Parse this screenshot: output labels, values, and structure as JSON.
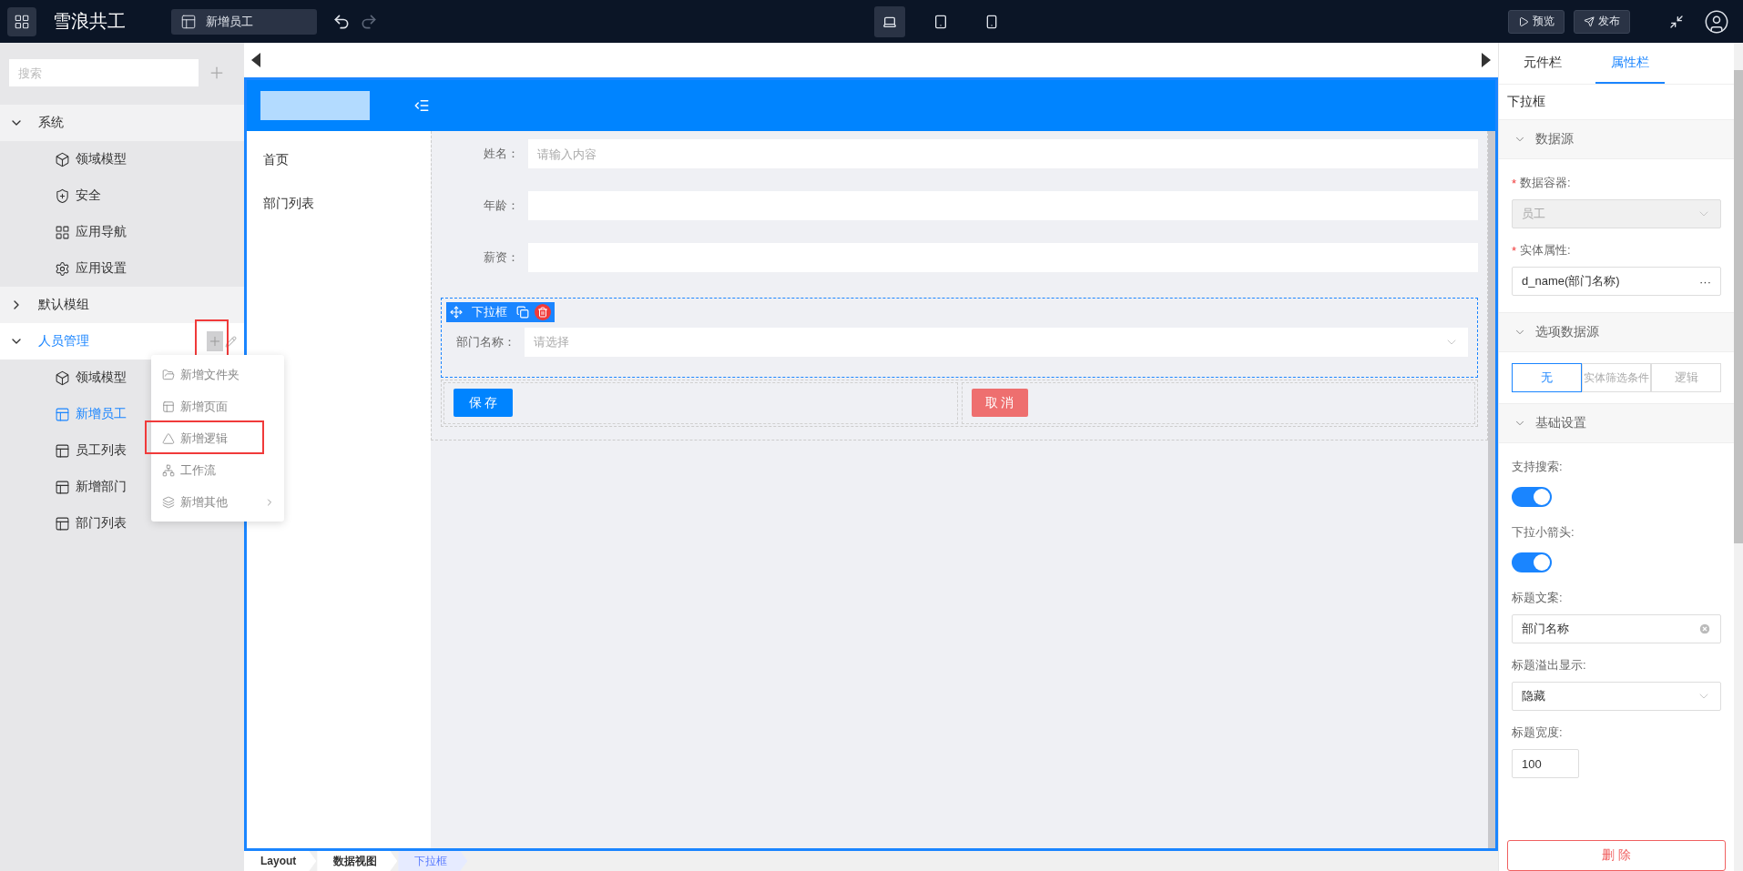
{
  "topbar": {
    "app_title": "雪浪共工",
    "page_tab": "新增员工",
    "devices": [
      {
        "kind": "desktop",
        "selected": true
      },
      {
        "kind": "tablet",
        "selected": false
      },
      {
        "kind": "phone",
        "selected": false
      }
    ],
    "buttons": [
      {
        "kind": "preview",
        "label": "预览"
      },
      {
        "kind": "publish",
        "label": "发布"
      }
    ]
  },
  "sidebar": {
    "search": {
      "placeholder": "搜索"
    },
    "groups": [
      {
        "label": "系统",
        "expanded": true,
        "selected": false,
        "children": [
          {
            "label": "领域模型",
            "kind": "model",
            "selected": false
          },
          {
            "label": "安全",
            "kind": "security",
            "selected": false
          },
          {
            "label": "应用导航",
            "kind": "nav",
            "selected": false
          },
          {
            "label": "应用设置",
            "kind": "settings",
            "selected": false
          }
        ]
      },
      {
        "label": "默认模组",
        "expanded": false,
        "selected": false
      },
      {
        "label": "人员管理",
        "expanded": true,
        "selected": true,
        "highlighted_add": true,
        "children": [
          {
            "label": "领域模型",
            "kind": "model",
            "selected": false
          },
          {
            "label": "新增员工",
            "kind": "page",
            "selected": true
          },
          {
            "label": "员工列表",
            "kind": "page",
            "selected": false
          },
          {
            "label": "新增部门",
            "kind": "page",
            "selected": false
          },
          {
            "label": "部门列表",
            "kind": "page",
            "selected": false
          }
        ]
      }
    ]
  },
  "context_menu": {
    "items": [
      {
        "label": "新增文件夹",
        "kind": "folder",
        "highlighted": false,
        "submenu": false
      },
      {
        "label": "新增页面",
        "kind": "page",
        "highlighted": false,
        "submenu": false
      },
      {
        "label": "新增逻辑",
        "kind": "logic",
        "highlighted": true,
        "submenu": false
      },
      {
        "label": "工作流",
        "kind": "workflow",
        "highlighted": false,
        "submenu": false
      },
      {
        "label": "新增其他",
        "kind": "other",
        "highlighted": false,
        "submenu": true
      }
    ]
  },
  "canvas": {
    "nav": [
      {
        "label": "首页"
      },
      {
        "label": "部门列表"
      }
    ],
    "fields": [
      {
        "label": "姓名：",
        "placeholder": "请输入内容"
      },
      {
        "label": "年龄："
      },
      {
        "label": "薪资："
      }
    ],
    "selected_component": {
      "toolbar_label": "下拉框",
      "label": "部门名称：",
      "placeholder": "请选择"
    },
    "buttons": [
      {
        "kind": "primary",
        "label": "保 存"
      },
      {
        "kind": "danger",
        "label": "取 消"
      }
    ]
  },
  "breadcrumb": [
    {
      "label": "Layout",
      "selected": false
    },
    {
      "label": "数据视图",
      "selected": false
    },
    {
      "label": "下拉框",
      "selected": true
    }
  ],
  "panel": {
    "tabs": [
      {
        "label": "元件栏",
        "selected": false
      },
      {
        "label": "属性栏",
        "selected": true
      }
    ],
    "title": "下拉框",
    "sections": [
      {
        "title": "数据源",
        "expanded": true,
        "fields": [
          {
            "kind": "select",
            "label": "数据容器:",
            "required_mark": "*",
            "value": "员工",
            "disabled": true
          },
          {
            "kind": "picker",
            "label": "实体属性:",
            "required_mark": "*",
            "value": "d_name(部门名称)",
            "action": "···"
          }
        ]
      },
      {
        "title": "选项数据源",
        "expanded": true,
        "fields": [
          {
            "kind": "segmented",
            "options": [
              {
                "label": "无",
                "selected": true
              },
              {
                "label": "实体筛选条件",
                "selected": false
              },
              {
                "label": "逻辑",
                "selected": false
              }
            ]
          }
        ]
      },
      {
        "title": "基础设置",
        "expanded": true,
        "fields": [
          {
            "kind": "switch",
            "label": "支持搜索:",
            "on": true
          },
          {
            "kind": "switch",
            "label": "下拉小箭头:",
            "on": true
          },
          {
            "kind": "text",
            "label": "标题文案:",
            "value": "部门名称"
          },
          {
            "kind": "select",
            "label": "标题溢出显示:",
            "value": "隐藏",
            "disabled": false
          },
          {
            "kind": "number",
            "label": "标题宽度:",
            "value": "100"
          }
        ]
      }
    ],
    "delete_button": "删 除"
  }
}
